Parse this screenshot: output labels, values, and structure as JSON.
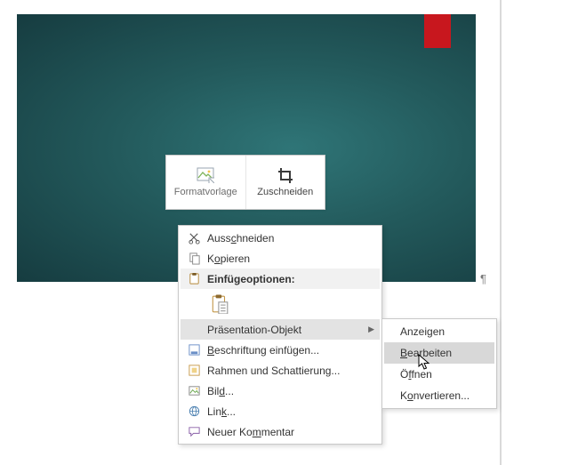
{
  "mini_toolbar": {
    "style_label": "Formatvorlage",
    "crop_label": "Zuschneiden"
  },
  "context_menu": {
    "cut": "Ausschneiden",
    "copy": "Kopieren",
    "paste_options": "Einfügeoptionen:",
    "presentation_object": "Präsentation-Objekt",
    "insert_caption": "Beschriftung einfügen...",
    "borders_shading": "Rahmen und Schattierung...",
    "picture": "Bild...",
    "link": "Link...",
    "new_comment": "Neuer Kommentar"
  },
  "submenu": {
    "show": "Anzeigen",
    "edit": "Bearbeiten",
    "open": "Öffnen",
    "convert": "Konvertieren..."
  }
}
